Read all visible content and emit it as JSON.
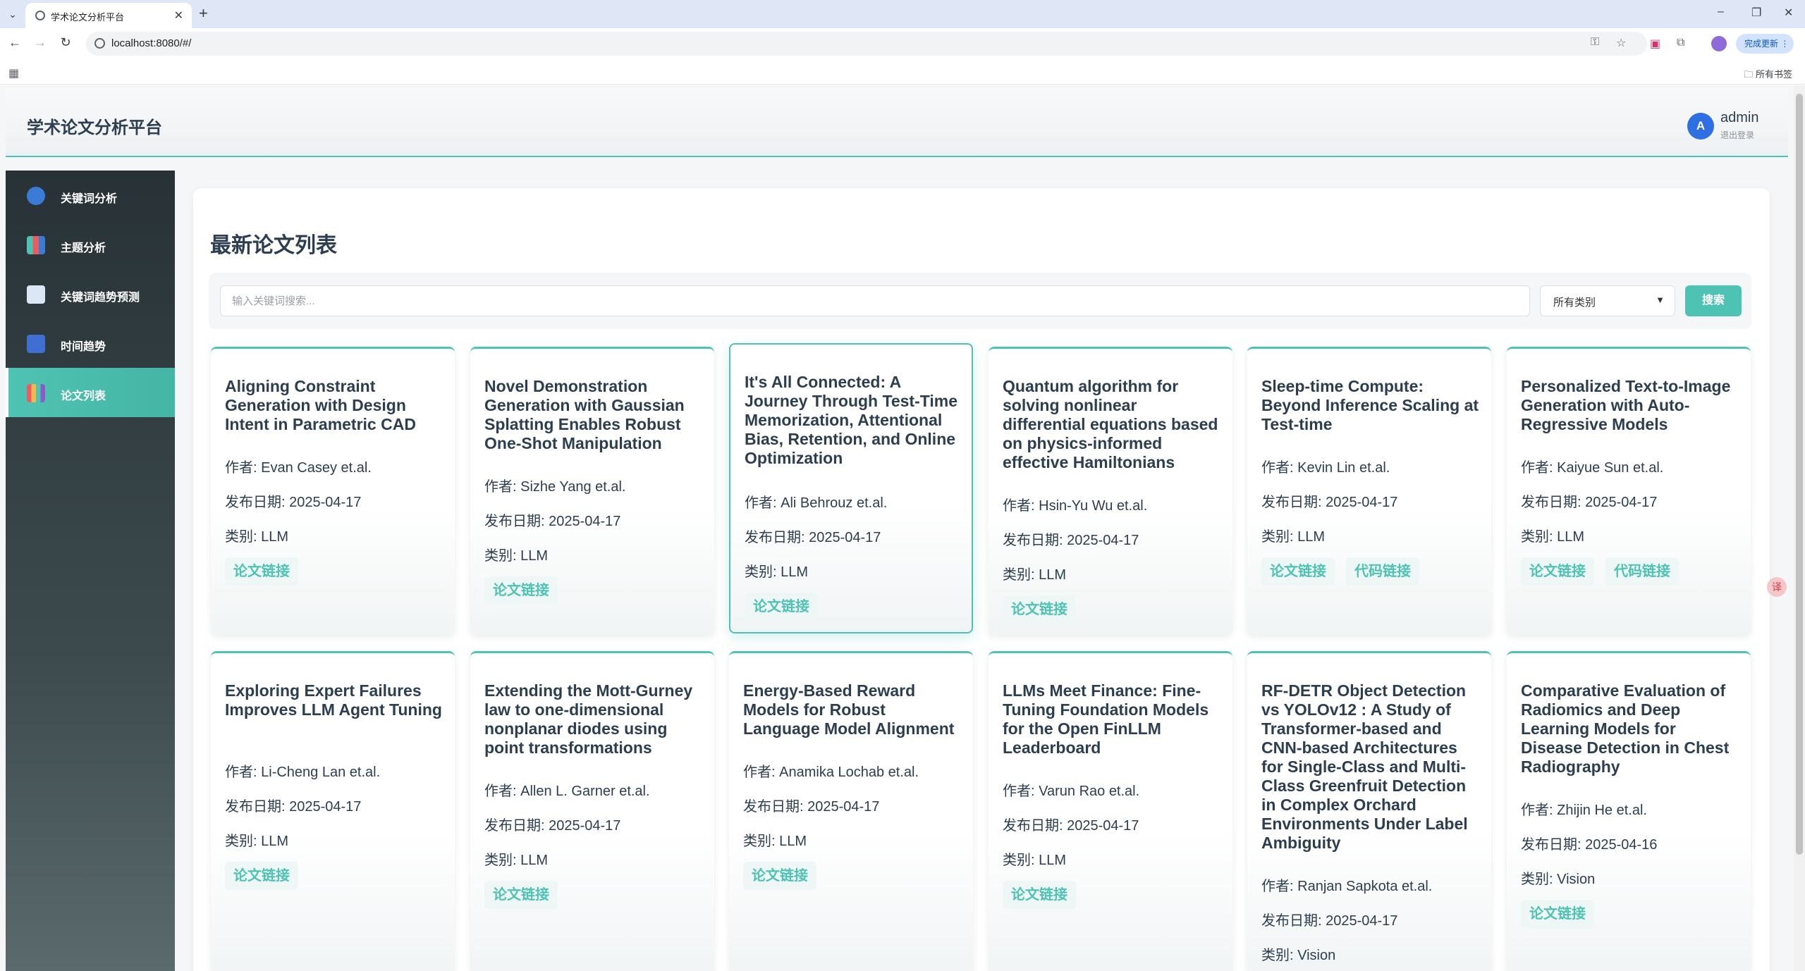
{
  "browser": {
    "tab_title": "学术论文分析平台",
    "url": "localhost:8080/#/",
    "update_label": "完成更新",
    "bookmarks_label": "所有书签"
  },
  "header": {
    "title": "学术论文分析平台",
    "avatar_initial": "A",
    "username": "admin",
    "logout": "退出登录"
  },
  "sidebar": {
    "items": [
      {
        "label": "关键词分析",
        "icon": "magnifier-icon",
        "color": "#3a7bd5"
      },
      {
        "label": "主题分析",
        "icon": "bar-chart-icon",
        "color": "#4fc3b3"
      },
      {
        "label": "关键词趋势预测",
        "icon": "trend-chart-icon",
        "color": "#7fa8d8"
      },
      {
        "label": "时间趋势",
        "icon": "calendar-icon",
        "color": "#3f6fd1"
      },
      {
        "label": "论文列表",
        "icon": "books-icon",
        "color": "#8a5cc7",
        "active": true
      }
    ]
  },
  "main": {
    "title": "最新论文列表",
    "search_placeholder": "输入关键词搜索...",
    "category": "所有类别",
    "search_button": "搜索",
    "author_label": "作者: ",
    "date_label": "发布日期: ",
    "category_label": "类别: ",
    "paper_link": "论文链接",
    "code_link": "代码链接",
    "papers": [
      {
        "title": "Aligning Constraint Generation with Design Intent in Parametric CAD",
        "author": "Evan Casey et.al.",
        "date": "2025-04-17",
        "category": "LLM",
        "has_code": false
      },
      {
        "title": "Novel Demonstration Generation with Gaussian Splatting Enables Robust One-Shot Manipulation",
        "author": "Sizhe Yang et.al.",
        "date": "2025-04-17",
        "category": "LLM",
        "has_code": false
      },
      {
        "title": "It's All Connected: A Journey Through Test-Time Memorization, Attentional Bias, Retention, and Online Optimization",
        "author": "Ali Behrouz et.al.",
        "date": "2025-04-17",
        "category": "LLM",
        "has_code": false
      },
      {
        "title": "Quantum algorithm for solving nonlinear differential equations based on physics-informed effective Hamiltonians",
        "author": "Hsin-Yu Wu et.al.",
        "date": "2025-04-17",
        "category": "LLM",
        "has_code": false
      },
      {
        "title": "Sleep-time Compute: Beyond Inference Scaling at Test-time",
        "author": "Kevin Lin et.al.",
        "date": "2025-04-17",
        "category": "LLM",
        "has_code": true
      },
      {
        "title": "Personalized Text-to-Image Generation with Auto-Regressive Models",
        "author": "Kaiyue Sun et.al.",
        "date": "2025-04-17",
        "category": "LLM",
        "has_code": true
      },
      {
        "title": "Exploring Expert Failures Improves LLM Agent Tuning",
        "author": "Li-Cheng Lan et.al.",
        "date": "2025-04-17",
        "category": "LLM",
        "has_code": false
      },
      {
        "title": "Extending the Mott-Gurney law to one-dimensional nonplanar diodes using point transformations",
        "author": "Allen L. Garner et.al.",
        "date": "2025-04-17",
        "category": "LLM",
        "has_code": false
      },
      {
        "title": "Energy-Based Reward Models for Robust Language Model Alignment",
        "author": "Anamika Lochab et.al.",
        "date": "2025-04-17",
        "category": "LLM",
        "has_code": false
      },
      {
        "title": "LLMs Meet Finance: Fine-Tuning Foundation Models for the Open FinLLM Leaderboard",
        "author": "Varun Rao et.al.",
        "date": "2025-04-17",
        "category": "LLM",
        "has_code": false
      },
      {
        "title": "RF-DETR Object Detection vs YOLOv12 : A Study of Transformer-based and CNN-based Architectures for Single-Class and Multi-Class Greenfruit Detection in Complex Orchard Environments Under Label Ambiguity",
        "author": "Ranjan Sapkota et.al.",
        "date": "2025-04-17",
        "category": "Vision",
        "has_code": false
      },
      {
        "title": "Comparative Evaluation of Radiomics and Deep Learning Models for Disease Detection in Chest Radiography",
        "author": "Zhijin He et.al.",
        "date": "2025-04-16",
        "category": "Vision",
        "has_code": false
      }
    ]
  }
}
